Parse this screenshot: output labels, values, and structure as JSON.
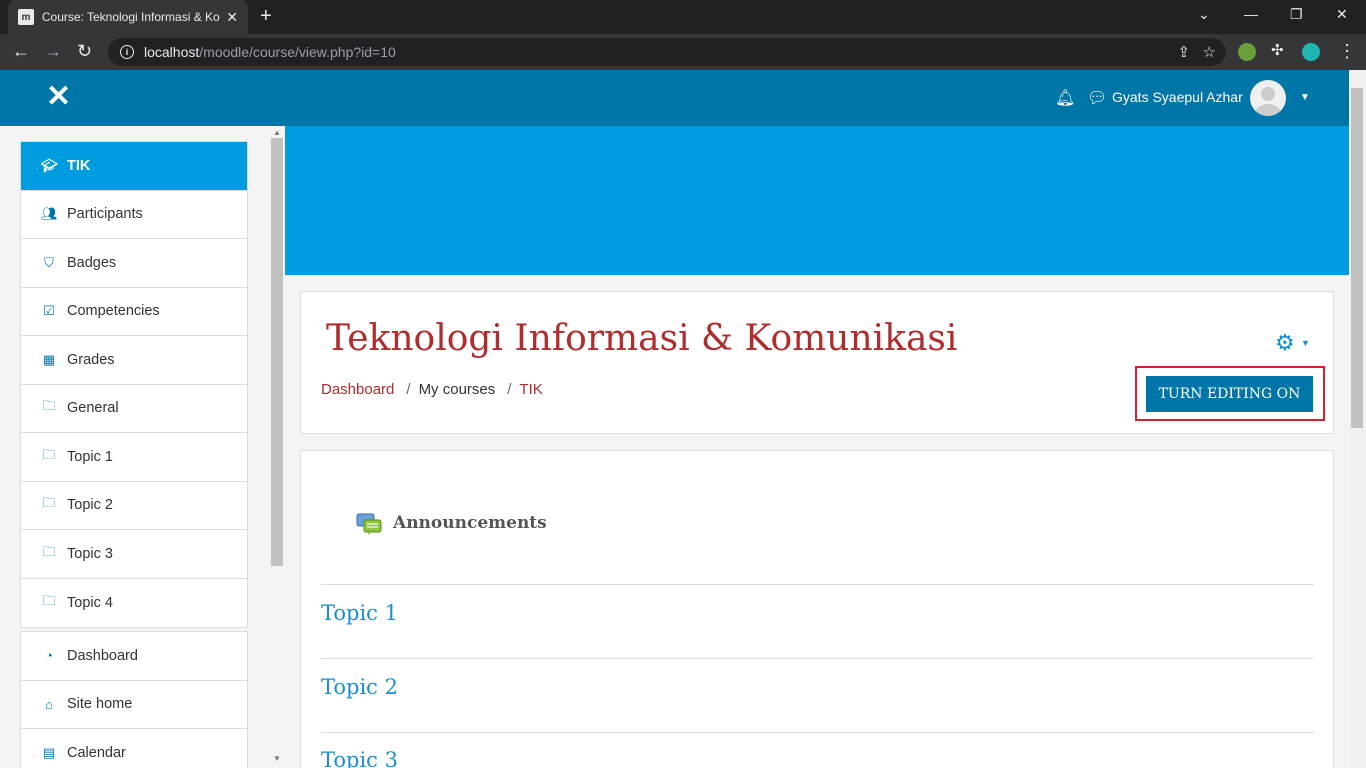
{
  "browser": {
    "tab_title": "Course: Teknologi Informasi & Komunikasi",
    "url_host": "localhost",
    "url_path": "/moodle/course/view.php?id=10"
  },
  "navbar": {
    "user_name": "Gyats Syaepul Azhar"
  },
  "sidebar": {
    "course_items": [
      {
        "label": "TIK",
        "icon": "graduation-cap-icon"
      },
      {
        "label": "Participants",
        "icon": "users-icon"
      },
      {
        "label": "Badges",
        "icon": "shield-icon"
      },
      {
        "label": "Competencies",
        "icon": "check-square-icon"
      },
      {
        "label": "Grades",
        "icon": "table-icon"
      },
      {
        "label": "General",
        "icon": "folder-icon"
      },
      {
        "label": "Topic 1",
        "icon": "folder-icon"
      },
      {
        "label": "Topic 2",
        "icon": "folder-icon"
      },
      {
        "label": "Topic 3",
        "icon": "folder-icon"
      },
      {
        "label": "Topic 4",
        "icon": "folder-icon"
      }
    ],
    "site_items": [
      {
        "label": "Dashboard",
        "icon": "dashboard-icon"
      },
      {
        "label": "Site home",
        "icon": "home-icon"
      },
      {
        "label": "Calendar",
        "icon": "calendar-icon"
      }
    ]
  },
  "header": {
    "course_title": "Teknologi Informasi & Komunikasi",
    "breadcrumb": [
      "Dashboard",
      "My courses",
      "TIK"
    ],
    "edit_button": "TURN EDITING ON"
  },
  "content": {
    "announcements": "Announcements",
    "sections": [
      "Topic 1",
      "Topic 2",
      "Topic 3"
    ]
  },
  "colors": {
    "navbar": "#0076a8",
    "banner": "#009ce0",
    "title": "#b02d2d",
    "link": "#1a8fd1",
    "highlight": "#d6202f"
  }
}
